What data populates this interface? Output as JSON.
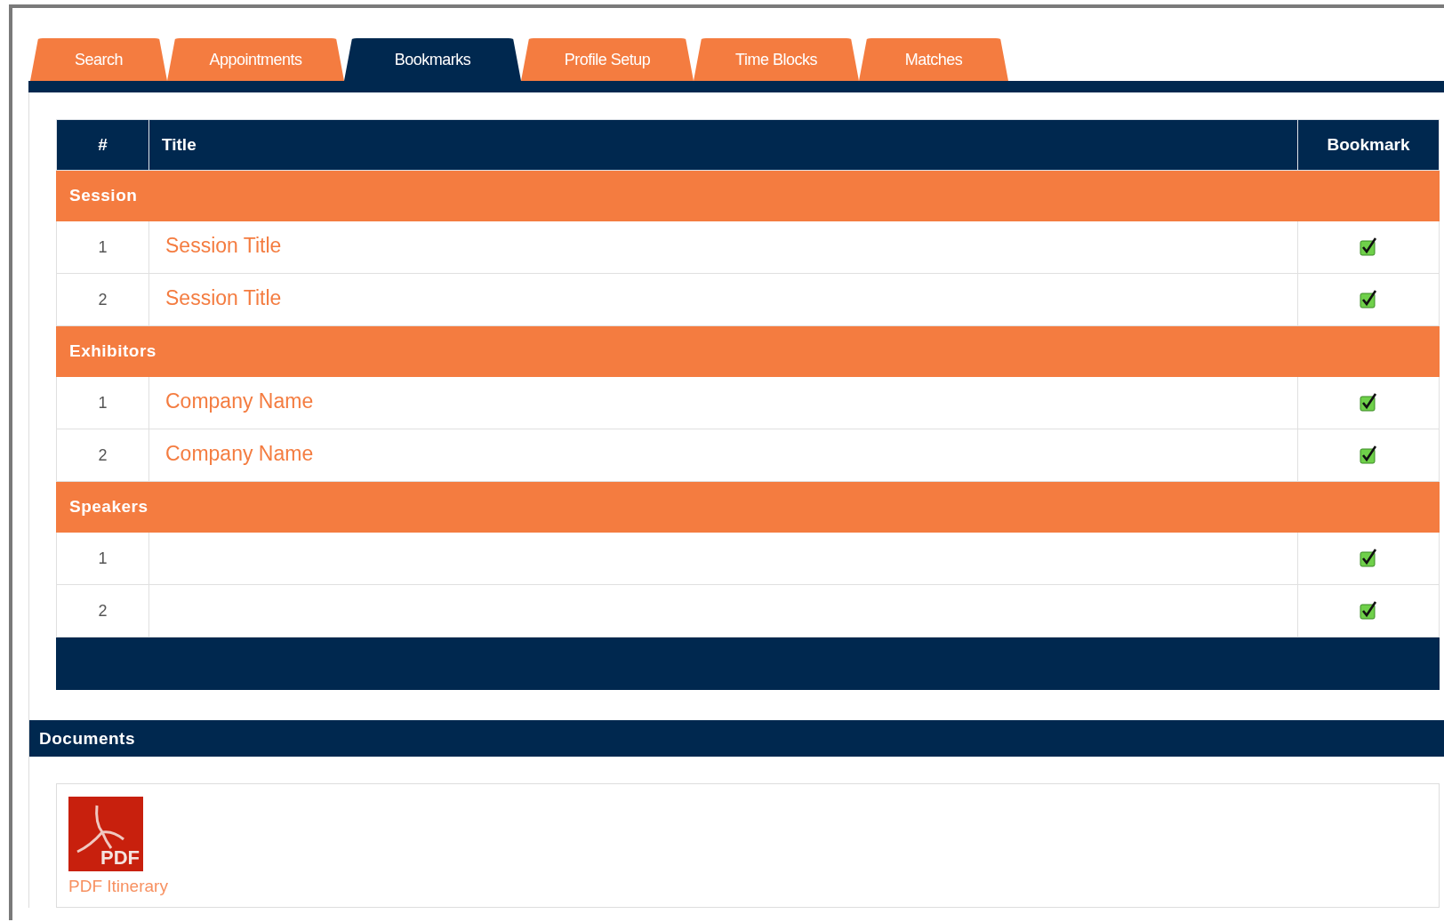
{
  "tabs": [
    {
      "label": "Search",
      "selected": false
    },
    {
      "label": "Appointments",
      "selected": false
    },
    {
      "label": "Bookmarks",
      "selected": true
    },
    {
      "label": "Profile Setup",
      "selected": false
    },
    {
      "label": "Time Blocks",
      "selected": false
    },
    {
      "label": "Matches",
      "selected": false
    }
  ],
  "table": {
    "columns": [
      "#",
      "Title",
      "Bookmark"
    ],
    "groups": [
      {
        "name": "Session",
        "rows": [
          {
            "number": "1",
            "title": "Session Title",
            "bookmarked": true
          },
          {
            "number": "2",
            "title": "Session Title",
            "bookmarked": true
          }
        ]
      },
      {
        "name": "Exhibitors",
        "rows": [
          {
            "number": "1",
            "title": "Company Name",
            "bookmarked": true
          },
          {
            "number": "2",
            "title": "Company Name",
            "bookmarked": true
          }
        ]
      },
      {
        "name": "Speakers",
        "rows": [
          {
            "number": "1",
            "bookmarked": true
          },
          {
            "number": "2",
            "bookmarked": true
          }
        ]
      }
    ]
  },
  "documents": {
    "title": "Documents",
    "items": [
      {
        "icon_label": "PDF",
        "label": "PDF Itinerary"
      }
    ]
  }
}
